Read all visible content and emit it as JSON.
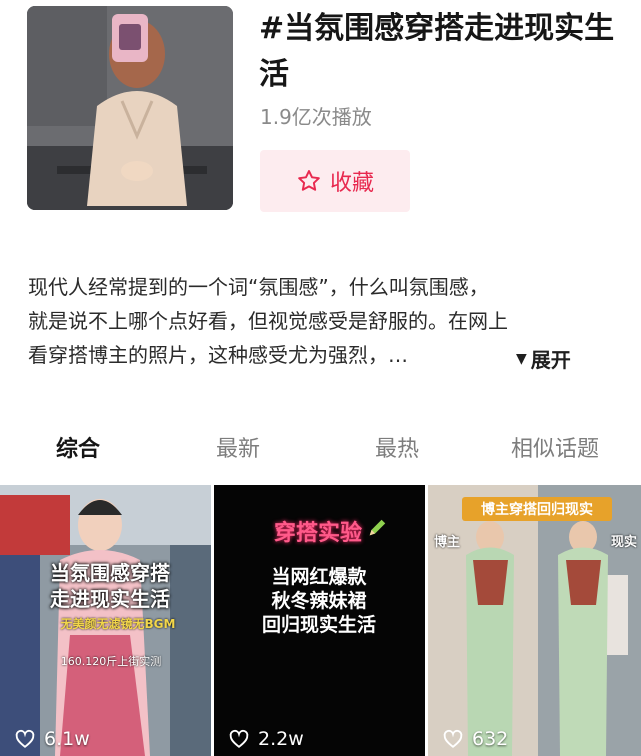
{
  "topic": {
    "title": "#当氛围感穿搭走进现实生活",
    "play_count": "1.9亿次播放",
    "favorite_label": "收藏"
  },
  "description": {
    "lines": [
      "现代人经常提到的一个词“氛围感”，什么叫氛围感，",
      "就是说不上哪个点好看，但视觉感受是舒服的。在网上",
      "看穿搭博主的照片，这种感受尤为强烈，…"
    ],
    "expand_label": "展开"
  },
  "tabs": [
    {
      "label": "综合",
      "active": true
    },
    {
      "label": "最新",
      "active": false
    },
    {
      "label": "最热",
      "active": false
    },
    {
      "label": "相似话题",
      "active": false
    }
  ],
  "videos": [
    {
      "overlay": [
        "当氛围感穿搭",
        "走进现实生活"
      ],
      "subline": "无美颜无滤镜无BGM",
      "footnote": "160.120斤上街实测",
      "likes": "6.1w"
    },
    {
      "overlay": [
        "穿搭实验"
      ],
      "lines": [
        "当网红爆款",
        "秋冬辣妹裙",
        "回归现实生活"
      ],
      "likes": "2.2w"
    },
    {
      "overlay": [
        "博主穿搭回归现实"
      ],
      "side_left": "博主",
      "side_right": "现实",
      "likes": "632"
    }
  ],
  "colors": {
    "accent": "#e8294f",
    "favorite_bg": "#fdecef",
    "muted_text": "#8a8a8a"
  }
}
